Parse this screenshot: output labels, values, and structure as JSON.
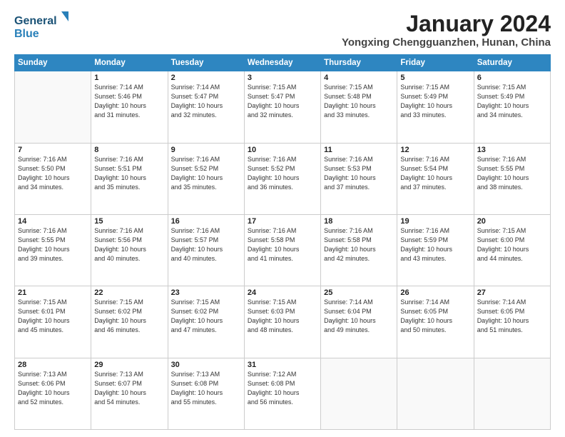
{
  "header": {
    "logo_general": "General",
    "logo_blue": "Blue",
    "month_title": "January 2024",
    "location": "Yongxing Chengguanzhen, Hunan, China"
  },
  "days_of_week": [
    "Sunday",
    "Monday",
    "Tuesday",
    "Wednesday",
    "Thursday",
    "Friday",
    "Saturday"
  ],
  "weeks": [
    [
      {
        "day": "",
        "info": ""
      },
      {
        "day": "1",
        "info": "Sunrise: 7:14 AM\nSunset: 5:46 PM\nDaylight: 10 hours\nand 31 minutes."
      },
      {
        "day": "2",
        "info": "Sunrise: 7:14 AM\nSunset: 5:47 PM\nDaylight: 10 hours\nand 32 minutes."
      },
      {
        "day": "3",
        "info": "Sunrise: 7:15 AM\nSunset: 5:47 PM\nDaylight: 10 hours\nand 32 minutes."
      },
      {
        "day": "4",
        "info": "Sunrise: 7:15 AM\nSunset: 5:48 PM\nDaylight: 10 hours\nand 33 minutes."
      },
      {
        "day": "5",
        "info": "Sunrise: 7:15 AM\nSunset: 5:49 PM\nDaylight: 10 hours\nand 33 minutes."
      },
      {
        "day": "6",
        "info": "Sunrise: 7:15 AM\nSunset: 5:49 PM\nDaylight: 10 hours\nand 34 minutes."
      }
    ],
    [
      {
        "day": "7",
        "info": "Sunrise: 7:16 AM\nSunset: 5:50 PM\nDaylight: 10 hours\nand 34 minutes."
      },
      {
        "day": "8",
        "info": "Sunrise: 7:16 AM\nSunset: 5:51 PM\nDaylight: 10 hours\nand 35 minutes."
      },
      {
        "day": "9",
        "info": "Sunrise: 7:16 AM\nSunset: 5:52 PM\nDaylight: 10 hours\nand 35 minutes."
      },
      {
        "day": "10",
        "info": "Sunrise: 7:16 AM\nSunset: 5:52 PM\nDaylight: 10 hours\nand 36 minutes."
      },
      {
        "day": "11",
        "info": "Sunrise: 7:16 AM\nSunset: 5:53 PM\nDaylight: 10 hours\nand 37 minutes."
      },
      {
        "day": "12",
        "info": "Sunrise: 7:16 AM\nSunset: 5:54 PM\nDaylight: 10 hours\nand 37 minutes."
      },
      {
        "day": "13",
        "info": "Sunrise: 7:16 AM\nSunset: 5:55 PM\nDaylight: 10 hours\nand 38 minutes."
      }
    ],
    [
      {
        "day": "14",
        "info": "Sunrise: 7:16 AM\nSunset: 5:55 PM\nDaylight: 10 hours\nand 39 minutes."
      },
      {
        "day": "15",
        "info": "Sunrise: 7:16 AM\nSunset: 5:56 PM\nDaylight: 10 hours\nand 40 minutes."
      },
      {
        "day": "16",
        "info": "Sunrise: 7:16 AM\nSunset: 5:57 PM\nDaylight: 10 hours\nand 40 minutes."
      },
      {
        "day": "17",
        "info": "Sunrise: 7:16 AM\nSunset: 5:58 PM\nDaylight: 10 hours\nand 41 minutes."
      },
      {
        "day": "18",
        "info": "Sunrise: 7:16 AM\nSunset: 5:58 PM\nDaylight: 10 hours\nand 42 minutes."
      },
      {
        "day": "19",
        "info": "Sunrise: 7:16 AM\nSunset: 5:59 PM\nDaylight: 10 hours\nand 43 minutes."
      },
      {
        "day": "20",
        "info": "Sunrise: 7:15 AM\nSunset: 6:00 PM\nDaylight: 10 hours\nand 44 minutes."
      }
    ],
    [
      {
        "day": "21",
        "info": "Sunrise: 7:15 AM\nSunset: 6:01 PM\nDaylight: 10 hours\nand 45 minutes."
      },
      {
        "day": "22",
        "info": "Sunrise: 7:15 AM\nSunset: 6:02 PM\nDaylight: 10 hours\nand 46 minutes."
      },
      {
        "day": "23",
        "info": "Sunrise: 7:15 AM\nSunset: 6:02 PM\nDaylight: 10 hours\nand 47 minutes."
      },
      {
        "day": "24",
        "info": "Sunrise: 7:15 AM\nSunset: 6:03 PM\nDaylight: 10 hours\nand 48 minutes."
      },
      {
        "day": "25",
        "info": "Sunrise: 7:14 AM\nSunset: 6:04 PM\nDaylight: 10 hours\nand 49 minutes."
      },
      {
        "day": "26",
        "info": "Sunrise: 7:14 AM\nSunset: 6:05 PM\nDaylight: 10 hours\nand 50 minutes."
      },
      {
        "day": "27",
        "info": "Sunrise: 7:14 AM\nSunset: 6:05 PM\nDaylight: 10 hours\nand 51 minutes."
      }
    ],
    [
      {
        "day": "28",
        "info": "Sunrise: 7:13 AM\nSunset: 6:06 PM\nDaylight: 10 hours\nand 52 minutes."
      },
      {
        "day": "29",
        "info": "Sunrise: 7:13 AM\nSunset: 6:07 PM\nDaylight: 10 hours\nand 54 minutes."
      },
      {
        "day": "30",
        "info": "Sunrise: 7:13 AM\nSunset: 6:08 PM\nDaylight: 10 hours\nand 55 minutes."
      },
      {
        "day": "31",
        "info": "Sunrise: 7:12 AM\nSunset: 6:08 PM\nDaylight: 10 hours\nand 56 minutes."
      },
      {
        "day": "",
        "info": ""
      },
      {
        "day": "",
        "info": ""
      },
      {
        "day": "",
        "info": ""
      }
    ]
  ]
}
